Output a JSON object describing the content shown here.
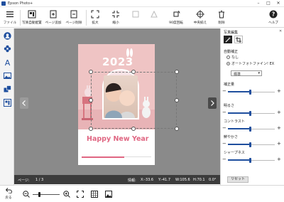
{
  "app": {
    "title": "Epson Photo+"
  },
  "toolbar": {
    "file": "ファイル",
    "photo_layout": "写真自動配置",
    "add_page": "ページ追加",
    "delete_page": "ページ削除",
    "enlarge": "拡大",
    "shrink": "縮小",
    "rotate90": "90度回転",
    "center": "中央揃え",
    "delete": "削除",
    "help": "ヘルプ"
  },
  "canvas": {
    "year": "2023",
    "greeting": "Happy New Year"
  },
  "status": {
    "page_label": "ページ:",
    "page_value": "1 / 3",
    "info_label": "情報:",
    "x": "X:-33.6",
    "y": "Y:-41.7",
    "w": "W:105.6",
    "h": "H:70.1",
    "angle": "0.0°"
  },
  "panel": {
    "title": "写真編集",
    "auto_correct": "自動補正",
    "opt_none": "なし",
    "opt_auto": "オートフォトファイン! EX",
    "preset": "標準",
    "brightness_corr": "補正量",
    "lightness": "明るさ",
    "contrast": "コントラスト",
    "vividness": "鮮やかさ",
    "sharpness": "シャープネス",
    "reset": "リセット"
  },
  "sliders": {
    "brightness_corr": 0.48,
    "lightness": 0.48,
    "contrast": 0.48,
    "vividness": 0.48,
    "sharpness": 0.48
  },
  "bottom": {
    "back": "戻る",
    "zoom": 0.25
  },
  "colors": {
    "accent": "#1f4f9e",
    "greeting": "#e06682",
    "status_bg": "#3c3c3c"
  }
}
